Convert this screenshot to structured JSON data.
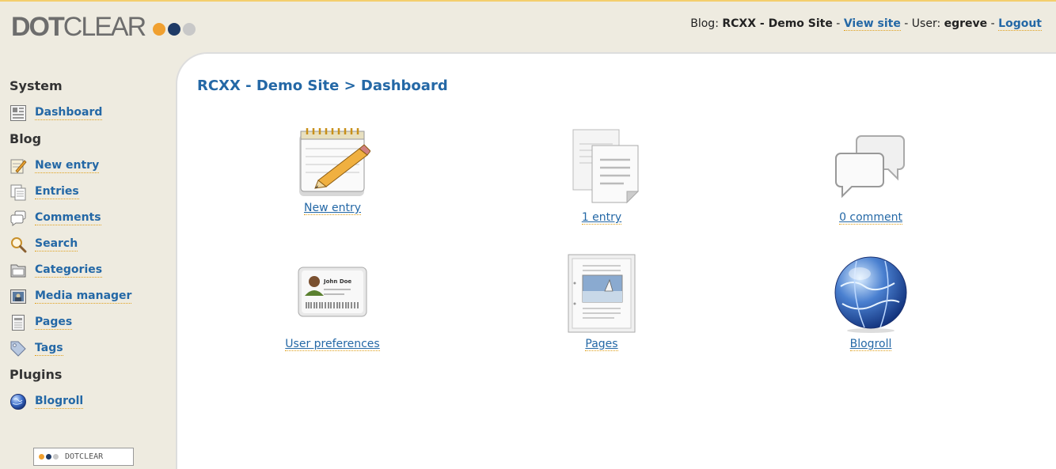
{
  "header": {
    "logo_bold": "DOT",
    "logo_light": "CLEAR",
    "blog_prefix": "Blog:",
    "blog_name": "RCXX - Demo Site",
    "separator": "-",
    "view_site": "View site",
    "user_prefix": "User:",
    "user_name": "egreve",
    "logout": "Logout"
  },
  "sidebar": {
    "sections": [
      {
        "title": "System"
      },
      {
        "title": "Blog"
      },
      {
        "title": "Plugins"
      }
    ],
    "items": [
      {
        "label": "Dashboard",
        "icon": "dashboard-icon"
      },
      {
        "label": "New entry",
        "icon": "pencil-icon"
      },
      {
        "label": "Entries",
        "icon": "entries-icon"
      },
      {
        "label": "Comments",
        "icon": "comment-icon"
      },
      {
        "label": "Search",
        "icon": "magnifier-icon"
      },
      {
        "label": "Categories",
        "icon": "folder-icon"
      },
      {
        "label": "Media manager",
        "icon": "image-icon"
      },
      {
        "label": "Pages",
        "icon": "page-icon"
      },
      {
        "label": "Tags",
        "icon": "tag-icon"
      },
      {
        "label": "Blogroll",
        "icon": "globe-icon"
      }
    ],
    "footer_badge": "DOTCLEAR"
  },
  "main": {
    "breadcrumb": "RCXX - Demo Site > Dashboard",
    "shortcuts": [
      {
        "label": "New entry",
        "icon": "notepad-pencil-icon"
      },
      {
        "label": "1 entry",
        "icon": "documents-icon"
      },
      {
        "label": "0 comment",
        "icon": "speech-bubbles-icon"
      },
      {
        "label": "User preferences",
        "icon": "id-card-icon"
      },
      {
        "label": "Pages",
        "icon": "page-image-icon"
      },
      {
        "label": "Blogroll",
        "icon": "globe-icon"
      }
    ]
  },
  "colors": {
    "link": "#2468a6",
    "underline": "#e0a01c",
    "background": "#eeebe0",
    "dot_orange": "#f0a030",
    "dot_navy": "#1e3a66",
    "dot_gray": "#c8c8c8"
  }
}
